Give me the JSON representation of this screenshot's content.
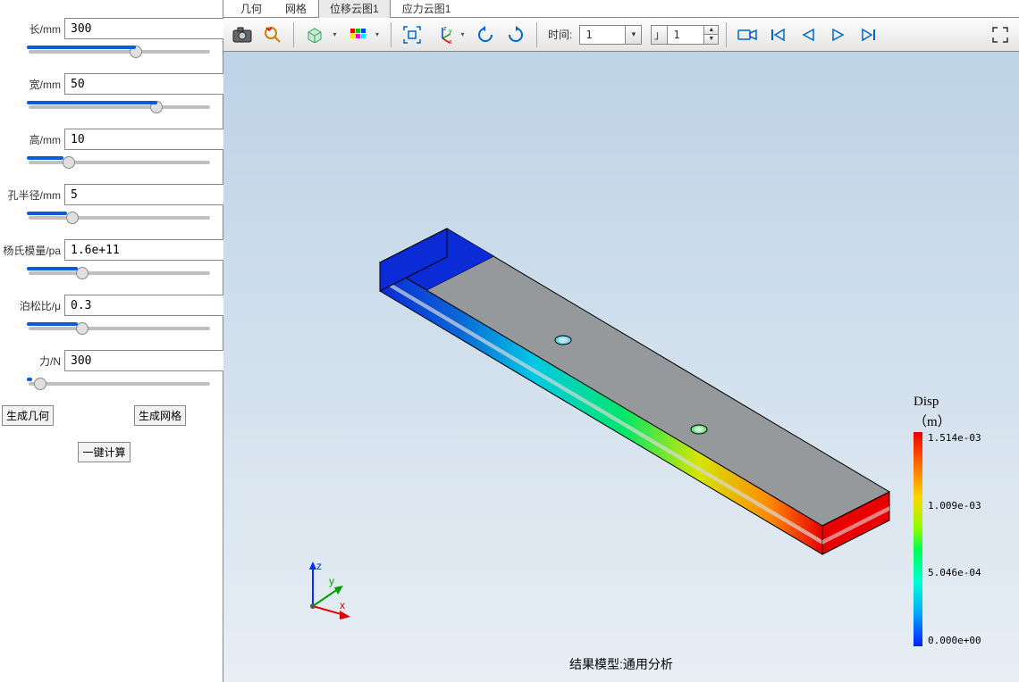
{
  "sidebar": {
    "params": [
      {
        "label": "长/mm",
        "value": "300",
        "fill": 60
      },
      {
        "label": "宽/mm",
        "value": "50",
        "fill": 72
      },
      {
        "label": "高/mm",
        "value": "10",
        "fill": 20
      },
      {
        "label": "孔半径/mm",
        "value": "5",
        "fill": 22
      },
      {
        "label": "杨氏模量/pa",
        "value": "1.6e+11",
        "fill": 28
      },
      {
        "label": "泊松比/μ",
        "value": "0.3",
        "fill": 28
      },
      {
        "label": "力/N",
        "value": "300",
        "fill": 3
      }
    ],
    "btn_geom": "生成几何",
    "btn_mesh": "生成网格",
    "btn_calc": "一键计算"
  },
  "tabs": [
    {
      "label": "几何",
      "active": false
    },
    {
      "label": "网格",
      "active": false
    },
    {
      "label": "位移云图1",
      "active": true
    },
    {
      "label": "应力云图1",
      "active": false
    }
  ],
  "toolbar": {
    "time_label": "时间:",
    "time_value": "1",
    "spinner_value": "1"
  },
  "viewport": {
    "result_label": "结果模型:通用分析",
    "axes": {
      "x": "x",
      "y": "y",
      "z": "z"
    }
  },
  "legend": {
    "title": "Disp",
    "unit": "（m）",
    "ticks": [
      "1.514e-03",
      "1.009e-03",
      "5.046e-04",
      "0.000e+00"
    ]
  }
}
